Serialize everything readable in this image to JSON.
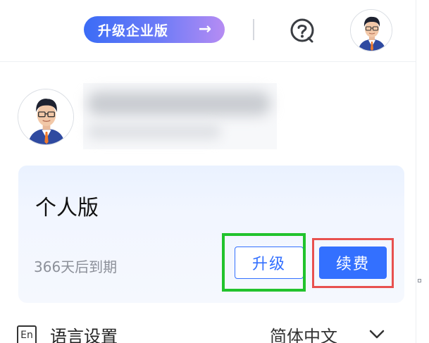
{
  "topbar": {
    "upgrade_pill_label": "升级企业版",
    "upgrade_pill_arrow": "→",
    "help_icon": "question-circle-icon",
    "avatar_icon": "user-avatar"
  },
  "profile": {
    "avatar_icon": "user-avatar"
  },
  "plan": {
    "name": "个人版",
    "expiry_text": "366天后到期",
    "upgrade_label": "升级",
    "renew_label": "续费"
  },
  "settings": {
    "language_icon_text": "En",
    "language_label": "语言设置",
    "language_value": "简体中文",
    "chevron_icon": "chevron-down-icon"
  },
  "colors": {
    "primary": "#3370ff",
    "highlight_green": "#22c32d",
    "highlight_red": "#e8514f"
  }
}
